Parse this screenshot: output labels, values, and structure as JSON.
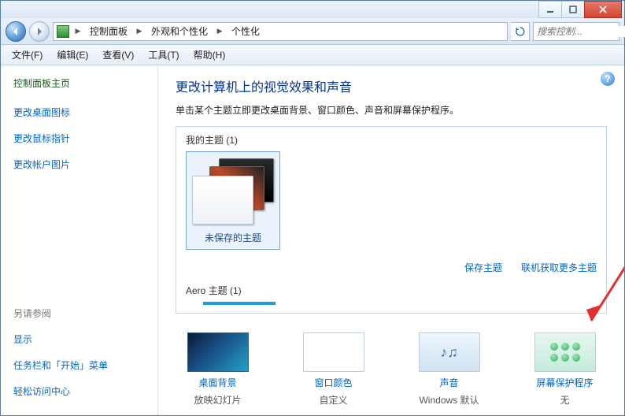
{
  "titlebar": {},
  "breadcrumb": {
    "items": [
      "控制面板",
      "外观和个性化",
      "个性化"
    ]
  },
  "search": {
    "placeholder": "搜索控制..."
  },
  "menu": {
    "file": "文件(F)",
    "edit": "编辑(E)",
    "view": "查看(V)",
    "tools": "工具(T)",
    "help": "帮助(H)"
  },
  "sidebar": {
    "home": "控制面板主页",
    "links": [
      "更改桌面图标",
      "更改鼠标指针",
      "更改帐户图片"
    ],
    "see_also_label": "另请参阅",
    "see_also": [
      "显示",
      "任务栏和「开始」菜单",
      "轻松访问中心"
    ]
  },
  "content": {
    "heading": "更改计算机上的视觉效果和声音",
    "subtext": "单击某个主题立即更改桌面背景、窗口颜色、声音和屏幕保护程序。",
    "my_themes_label": "我的主题 (1)",
    "unsaved_theme": "未保存的主题",
    "save_theme": "保存主题",
    "get_more_online": "联机获取更多主题",
    "aero_label": "Aero 主题 (1)",
    "bottom": {
      "bg_label": "桌面背景",
      "bg_sub": "放映幻灯片",
      "wc_label": "窗口颜色",
      "wc_sub": "自定义",
      "snd_label": "声音",
      "snd_sub": "Windows 默认",
      "scr_label": "屏幕保护程序",
      "scr_sub": "无"
    }
  }
}
